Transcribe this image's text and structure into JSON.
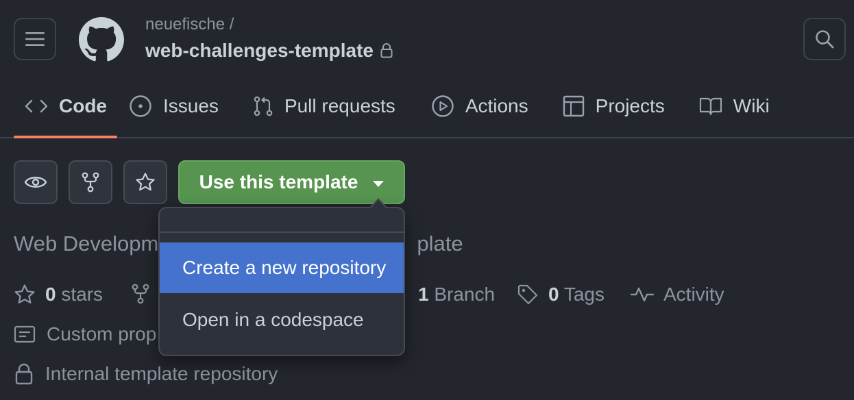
{
  "header": {
    "owner": "neuefische /",
    "repo_name": "web-challenges-template",
    "icons": {
      "menu": "hamburger-icon",
      "logo": "github-logo",
      "lock": "lock-icon",
      "search": "search-icon"
    }
  },
  "tabs": [
    {
      "label": "Code",
      "icon": "code-icon",
      "selected": true
    },
    {
      "label": "Issues",
      "icon": "issue-icon"
    },
    {
      "label": "Pull requests",
      "icon": "pull-request-icon"
    },
    {
      "label": "Actions",
      "icon": "play-icon"
    },
    {
      "label": "Projects",
      "icon": "table-icon"
    },
    {
      "label": "Wiki",
      "icon": "book-icon"
    }
  ],
  "buttons": {
    "use_template": "Use this template",
    "watch_icon": "eye-icon",
    "fork_icon": "fork-icon",
    "star_icon": "star-icon"
  },
  "description_visible": [
    "Web Developm",
    "plate"
  ],
  "stats": {
    "stars_count": "0",
    "stars_label": "stars",
    "branch_count": "1",
    "branch_label": "Branch",
    "tags_count": "0",
    "tags_label": "Tags",
    "activity_label": "Activity"
  },
  "custom_properties_visible": "Custom prop",
  "template_info": "Internal template repository",
  "dropdown": {
    "items": [
      {
        "label": "Create a new repository",
        "active": true
      },
      {
        "label": "Open in a codespace",
        "active": false
      }
    ]
  },
  "colors": {
    "background": "#24262e",
    "accent_underline": "#f78166",
    "primary_button": "#56944f",
    "menu_highlight": "#4472cc"
  }
}
